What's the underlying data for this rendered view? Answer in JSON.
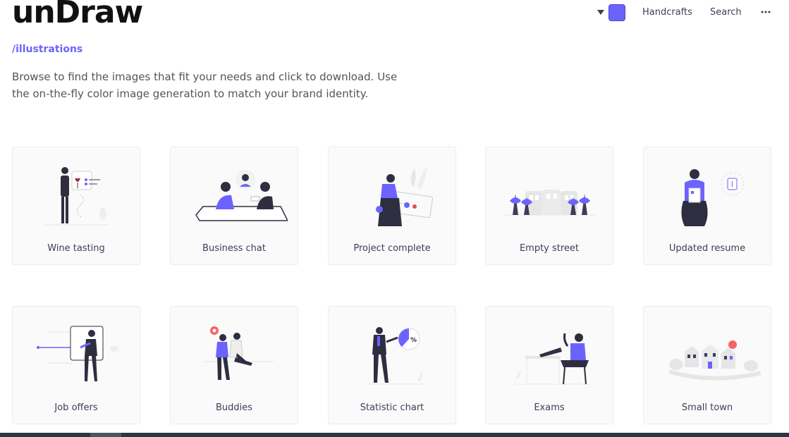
{
  "header": {
    "logo": "unDraw",
    "nav": {
      "handcrafts": "Handcrafts",
      "search": "Search"
    },
    "color_picker": {
      "value": "#6c63ff"
    },
    "more_icon": "more-dots-icon"
  },
  "hero": {
    "subtitle": "/illustrations",
    "description": "Browse to find the images that fit your needs and click to download. Use the on-the-fly color image generation to match your brand identity."
  },
  "colors": {
    "accent": "#6c63ff",
    "dark": "#2f2e41",
    "muted": "#e6e6e6"
  },
  "cards": [
    {
      "label": "Wine tasting"
    },
    {
      "label": "Business chat"
    },
    {
      "label": "Project complete"
    },
    {
      "label": "Empty street"
    },
    {
      "label": "Updated resume"
    },
    {
      "label": "Job offers"
    },
    {
      "label": "Buddies"
    },
    {
      "label": "Statistic chart"
    },
    {
      "label": "Exams"
    },
    {
      "label": "Small town"
    }
  ]
}
